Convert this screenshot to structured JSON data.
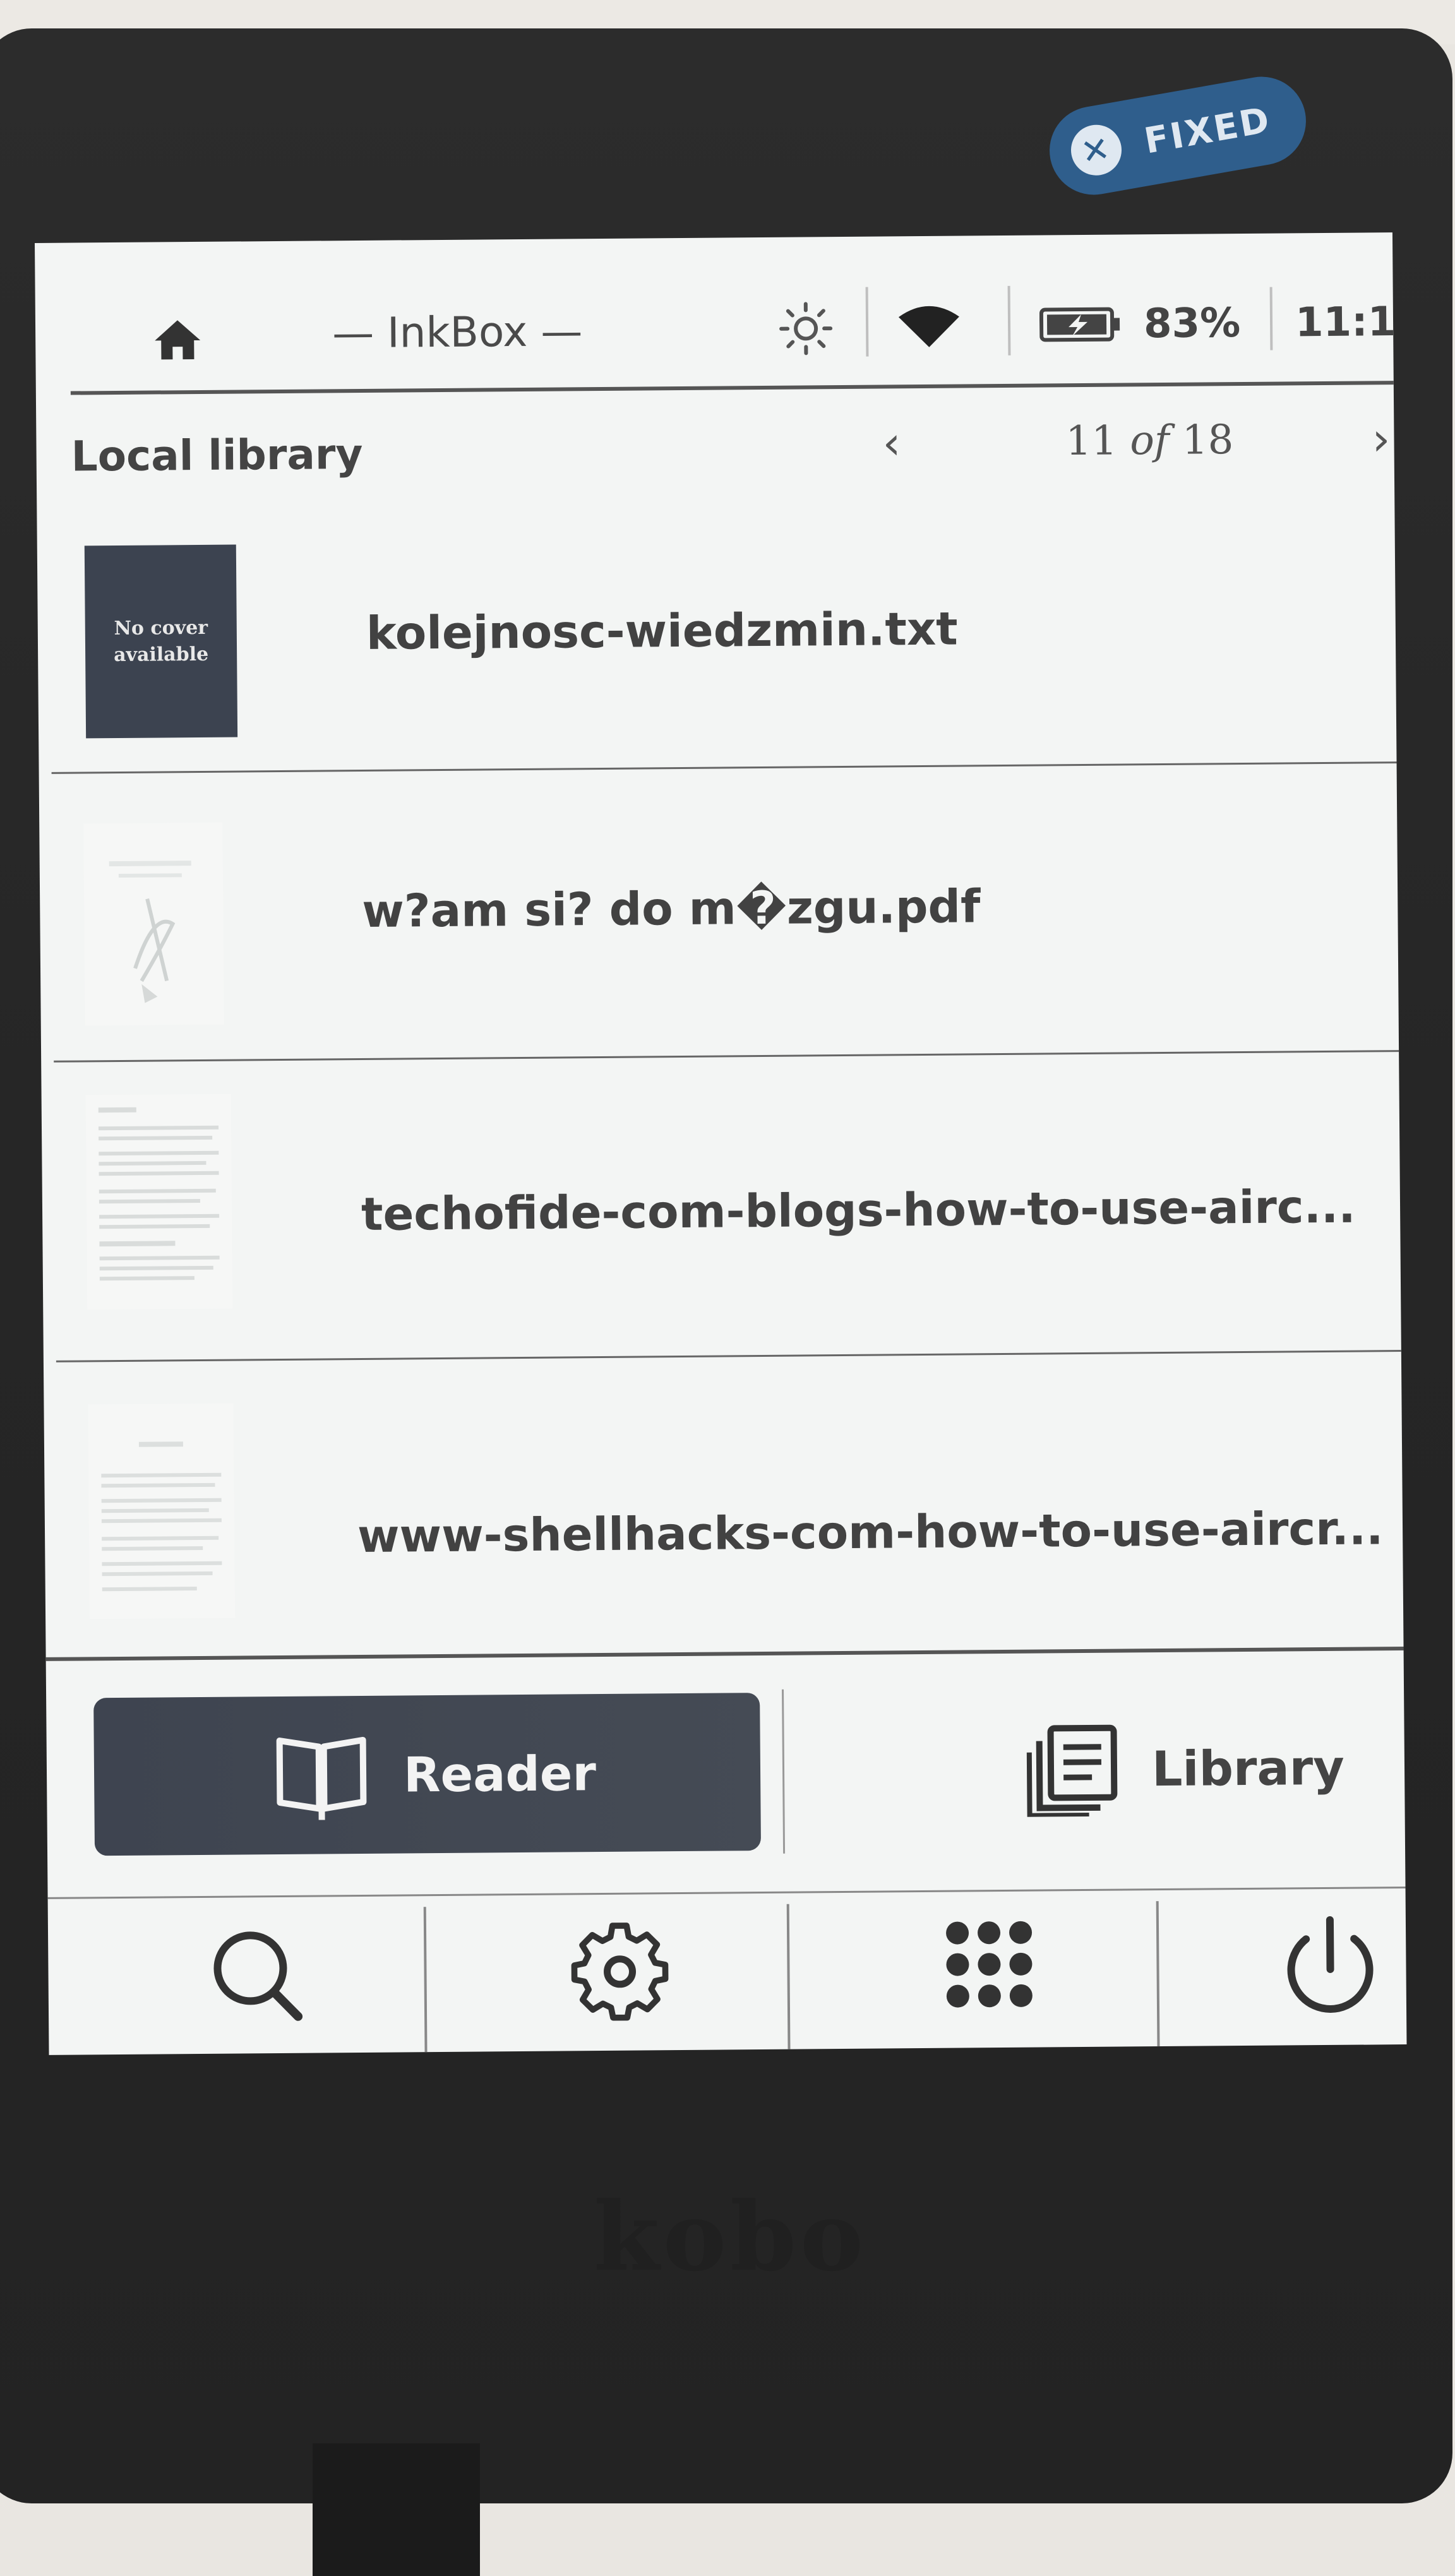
{
  "badge": {
    "label": "FIXED",
    "icon": "x-circle-icon",
    "color": "#2f5e8c"
  },
  "device": {
    "brand": "kobo"
  },
  "statusbar": {
    "home_icon": "home-icon",
    "app_title": "— InkBox —",
    "brightness_icon": "sun-icon",
    "wifi_icon": "wifi-icon",
    "battery_icon": "battery-charging-icon",
    "battery_percent": "83%",
    "clock": "11:1"
  },
  "library": {
    "title": "Local library",
    "page_current": "11",
    "page_of": "of",
    "page_total": "18",
    "prev_icon": "chevron-left-icon",
    "next_icon": "chevron-right-icon",
    "books": [
      {
        "title": "kolejnosc-wiedzmin.txt",
        "cover_text_1": "No cover",
        "cover_text_2": "available"
      },
      {
        "title": "w?am si? do m�zgu.pdf"
      },
      {
        "title": "techofide-com-blogs-how-to-use-airc..."
      },
      {
        "title": "www-shellhacks-com-how-to-use-aircr..."
      }
    ]
  },
  "buttons": {
    "reader_label": "Reader",
    "reader_icon": "open-book-icon",
    "library_label": "Library",
    "library_icon": "library-icon"
  },
  "nav": {
    "search_icon": "search-icon",
    "settings_icon": "gear-icon",
    "apps_icon": "apps-grid-icon",
    "power_icon": "power-icon"
  },
  "colors": {
    "screen_bg": "#f3f5f4",
    "button_dark": "#3e4450",
    "text": "#424242",
    "bezel": "#262626"
  }
}
